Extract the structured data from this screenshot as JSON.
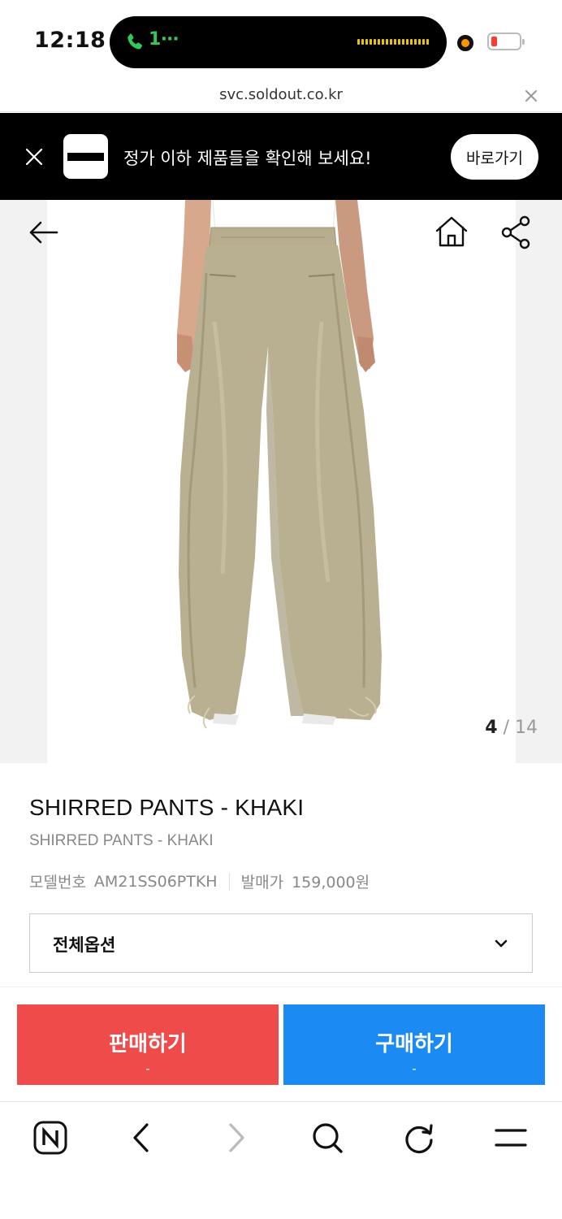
{
  "status_bar": {
    "time": "12:18",
    "call_text": "1⋯"
  },
  "url_bar": {
    "url": "svc.soldout.co.kr"
  },
  "banner": {
    "message": "정가 이하 제품들을 확인해 보세요!",
    "button_label": "바로가기"
  },
  "gallery": {
    "current": "4",
    "separator": " / ",
    "total": "14"
  },
  "product": {
    "title": "SHIRRED PANTS - KHAKI",
    "subtitle": "SHIRRED PANTS - KHAKI",
    "model_label": "모델번호",
    "model_value": "AM21SS06PTKH",
    "price_label": "발매가",
    "price_value": "159,000원"
  },
  "options": {
    "label": "전체옵션"
  },
  "actions": {
    "sell_label": "판매하기",
    "sell_price": "-",
    "buy_label": "구매하기",
    "buy_price": "-"
  },
  "colors": {
    "sell": "#ef4b4b",
    "buy": "#1b8af2",
    "banner_bg": "#000000",
    "call_green": "#34c759",
    "pants": "#b9b091"
  },
  "icons": {
    "back": "arrow-left-icon",
    "home": "home-icon",
    "share": "share-icon",
    "toolbar": [
      "naver-n-icon",
      "chevron-left-icon",
      "chevron-right-icon",
      "search-icon",
      "refresh-icon",
      "menu-icon"
    ]
  }
}
